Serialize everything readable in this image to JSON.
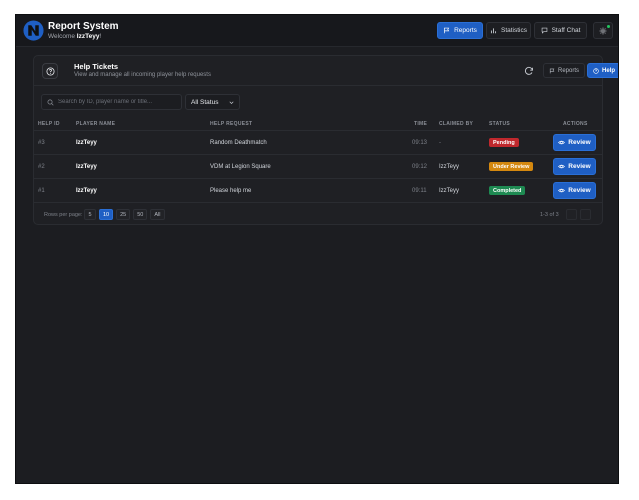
{
  "header": {
    "title": "Report System",
    "welcome_prefix": "Welcome",
    "username": "IzzTeyy",
    "welcome_suffix": "!",
    "nav": [
      {
        "label": "Reports",
        "icon": "flag-icon",
        "active": true
      },
      {
        "label": "Statistics",
        "icon": "bar-chart-icon",
        "active": false
      },
      {
        "label": "Staff Chat",
        "icon": "chat-icon",
        "active": false
      }
    ],
    "settings_icon": "gear-icon"
  },
  "card": {
    "title": "Help Tickets",
    "subtitle": "View and manage all incoming player help requests",
    "toggle": [
      {
        "label": "Reports",
        "active": false
      },
      {
        "label": "Help",
        "active": true
      }
    ]
  },
  "filters": {
    "search_placeholder": "Search by ID, player name or title...",
    "status_selected": "All Status"
  },
  "table": {
    "columns": [
      "HELP ID",
      "PLAYER NAME",
      "HELP REQUEST",
      "TIME",
      "CLAIMED BY",
      "STATUS",
      "ACTIONS"
    ],
    "rows": [
      {
        "id": "#3",
        "player": "IzzTeyy",
        "request": "Random Deathmatch",
        "time": "09:13",
        "claimed_by": "-",
        "status": "Pending",
        "status_color": "#c0282d",
        "action": "Review"
      },
      {
        "id": "#2",
        "player": "IzzTeyy",
        "request": "VDM at Legion Square",
        "time": "09:12",
        "claimed_by": "IzzTeyy",
        "status": "Under Review",
        "status_color": "#d4880f",
        "action": "Review"
      },
      {
        "id": "#1",
        "player": "IzzTeyy",
        "request": "Please help me",
        "time": "09:11",
        "claimed_by": "IzzTeyy",
        "status": "Completed",
        "status_color": "#1e8a52",
        "action": "Review"
      }
    ]
  },
  "pagination": {
    "rows_per_page_label": "Rows per page:",
    "options": [
      "5",
      "10",
      "25",
      "50",
      "All"
    ],
    "selected": "10",
    "range": "1-3 of 3"
  },
  "colors": {
    "accent": "#1f5fc4",
    "background": "#1c1d21"
  }
}
